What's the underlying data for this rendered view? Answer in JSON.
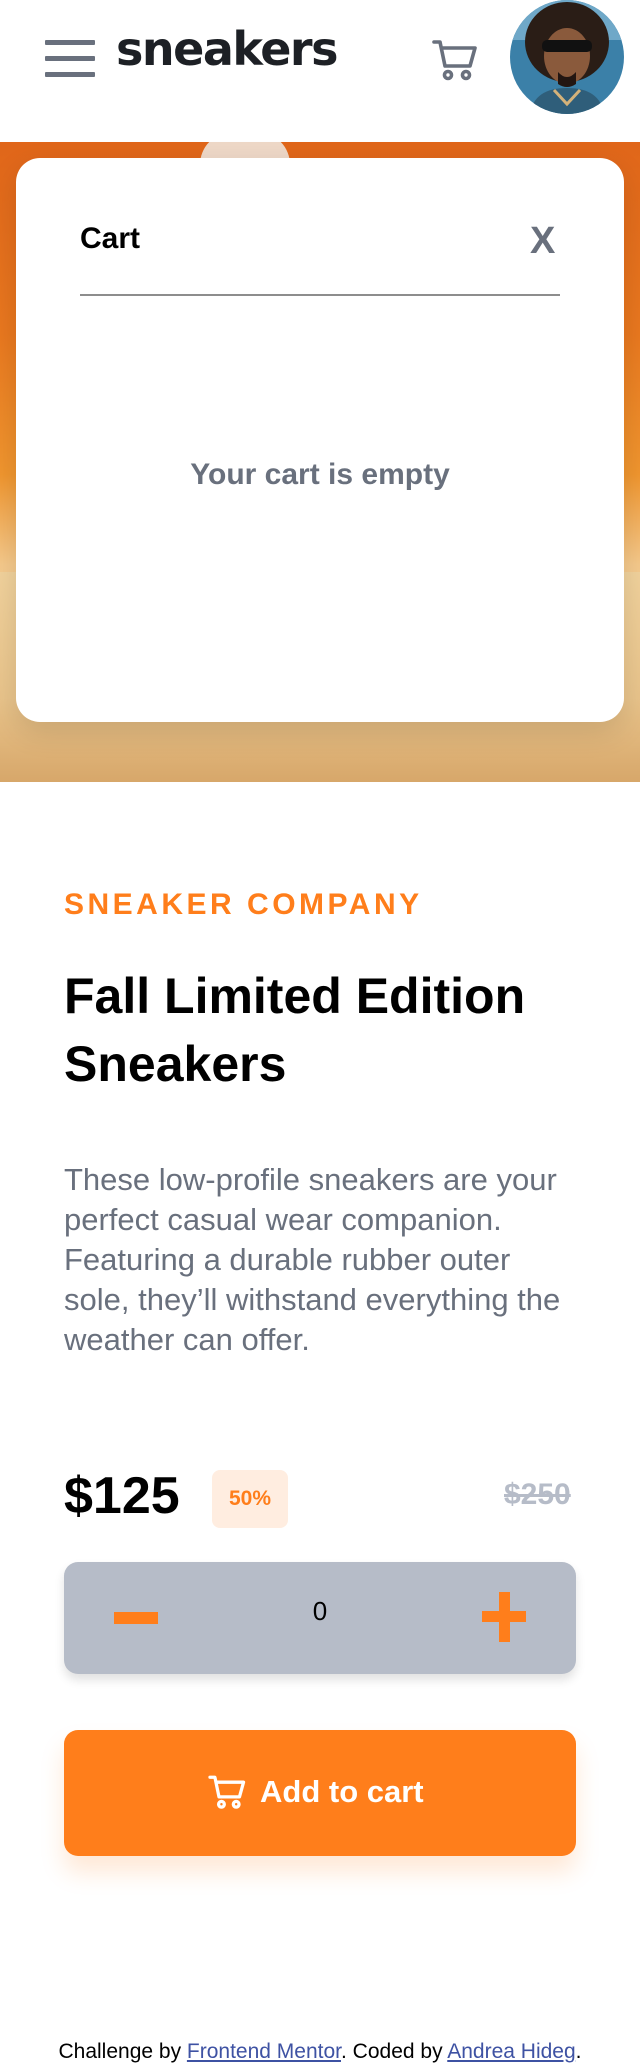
{
  "header": {
    "logo": "sneakers",
    "menu_icon": "hamburger-menu-icon",
    "cart_icon": "cart-icon",
    "avatar_icon": "user-avatar"
  },
  "cart": {
    "title": "Cart",
    "close_label": "X",
    "empty_message": "Your cart is empty"
  },
  "product": {
    "company": "SNEAKER COMPANY",
    "title": "Fall Limited Edition Sneakers",
    "description": "These low-profile sneakers are your perfect casual wear companion. Featuring a durable rubber outer sole, they’ll withstand everything the weather can offer.",
    "price": "$125",
    "discount": "50%",
    "old_price": "$250"
  },
  "quantity": {
    "value": "0",
    "minus_icon": "minus-icon",
    "plus_icon": "plus-icon"
  },
  "add_button": {
    "label": "Add to cart",
    "icon": "cart-icon"
  },
  "footer": {
    "prefix": "Challenge by ",
    "link1": "Frontend Mentor",
    "middle": ". Coded by ",
    "link2": "Andrea Hideg",
    "suffix": "."
  },
  "colors": {
    "accent": "#ff7e1b",
    "accent_pale": "#ffede0",
    "text_dark": "#1d2025",
    "text_gray": "#69707d",
    "gray_light": "#b6bcc8"
  }
}
